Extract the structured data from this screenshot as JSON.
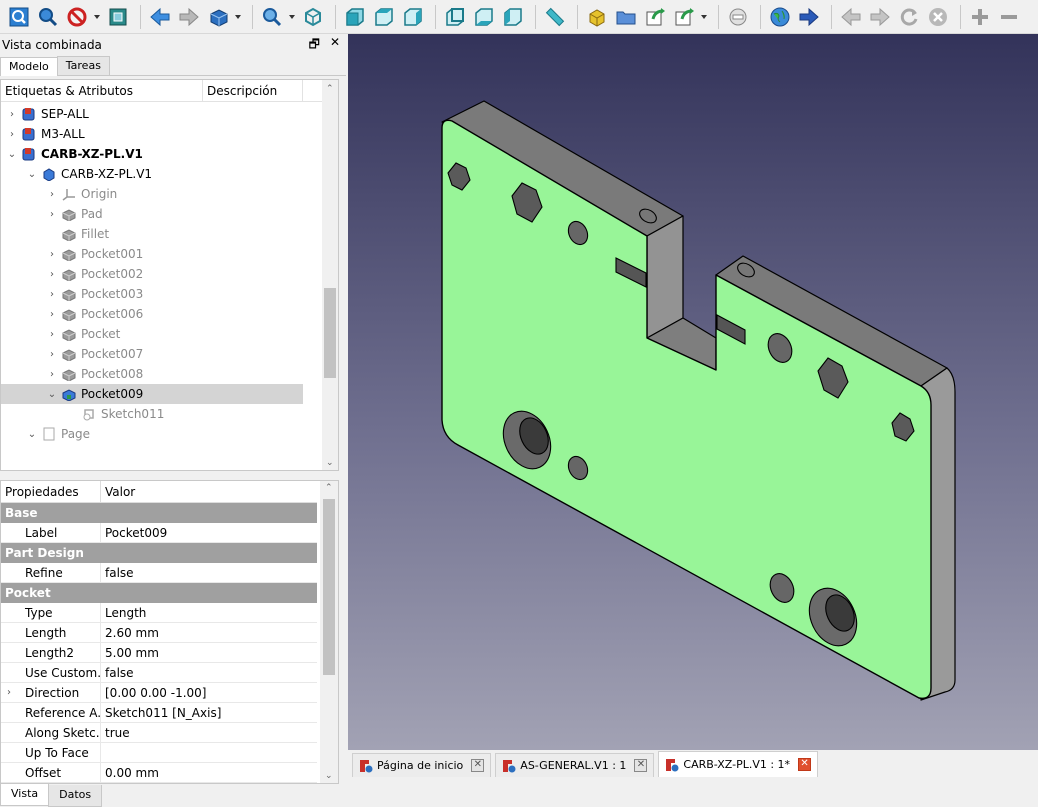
{
  "toolbar": {
    "icons": [
      "fit-all",
      "fit-selection",
      "draw-style",
      "bounding-box",
      "back",
      "forward",
      "navigation-cube",
      "zoom",
      "view-isometric",
      "view-front",
      "view-top",
      "view-right",
      "view-rear",
      "view-bottom",
      "view-left",
      "measure",
      "new-part",
      "new-group",
      "link",
      "link-actions",
      "stop",
      "web-home",
      "web-forward",
      "web-back",
      "web-forward-disabled",
      "refresh",
      "close",
      "zoom-in",
      "zoom-out"
    ]
  },
  "combo": {
    "title": "Vista combinada",
    "float_btn": "🗗",
    "close_btn": "✕",
    "tabs": [
      "Modelo",
      "Tareas"
    ]
  },
  "tree": {
    "col_labels": "Etiquetas & Atributos",
    "col_description": "Descripción",
    "rows": [
      {
        "label": "SEP-ALL",
        "arrow": "›",
        "indent": 0,
        "style": "normal"
      },
      {
        "label": "M3-ALL",
        "arrow": "›",
        "indent": 0,
        "style": "normal"
      },
      {
        "label": "CARB-XZ-PL.V1",
        "arrow": "⌄",
        "indent": 0,
        "style": "bold"
      },
      {
        "label": "CARB-XZ-PL.V1",
        "arrow": "⌄",
        "indent": 1,
        "style": "normal"
      },
      {
        "label": "Origin",
        "arrow": "›",
        "indent": 2,
        "style": "grey"
      },
      {
        "label": "Pad",
        "arrow": "›",
        "indent": 2,
        "style": "grey"
      },
      {
        "label": "Fillet",
        "arrow": "",
        "indent": 2,
        "style": "grey"
      },
      {
        "label": "Pocket001",
        "arrow": "›",
        "indent": 2,
        "style": "grey"
      },
      {
        "label": "Pocket002",
        "arrow": "›",
        "indent": 2,
        "style": "grey"
      },
      {
        "label": "Pocket003",
        "arrow": "›",
        "indent": 2,
        "style": "grey"
      },
      {
        "label": "Pocket006",
        "arrow": "›",
        "indent": 2,
        "style": "grey"
      },
      {
        "label": "Pocket",
        "arrow": "›",
        "indent": 2,
        "style": "grey"
      },
      {
        "label": "Pocket007",
        "arrow": "›",
        "indent": 2,
        "style": "grey"
      },
      {
        "label": "Pocket008",
        "arrow": "›",
        "indent": 2,
        "style": "grey"
      },
      {
        "label": "Pocket009",
        "arrow": "⌄",
        "indent": 2,
        "style": "selected"
      },
      {
        "label": "Sketch011",
        "arrow": "",
        "indent": 3,
        "style": "grey"
      },
      {
        "label": "Page",
        "arrow": "⌄",
        "indent": 1,
        "style": "grey"
      }
    ]
  },
  "props": {
    "col_property": "Propiedades",
    "col_value": "Valor",
    "groups": {
      "base": "Base",
      "part_design": "Part Design",
      "pocket": "Pocket"
    },
    "rows": {
      "label": {
        "k": "Label",
        "v": "Pocket009"
      },
      "refine": {
        "k": "Refine",
        "v": "false"
      },
      "type": {
        "k": "Type",
        "v": "Length"
      },
      "length": {
        "k": "Length",
        "v": "2.60 mm"
      },
      "length2": {
        "k": "Length2",
        "v": "5.00 mm"
      },
      "use_custom": {
        "k": "Use Custom...",
        "v": "false"
      },
      "direction": {
        "k": "Direction",
        "v": "[0.00 0.00 -1.00]"
      },
      "reference": {
        "k": "Reference A...",
        "v": "Sketch011 [N_Axis]"
      },
      "along": {
        "k": "Along Sketc...",
        "v": "true"
      },
      "up_to_face": {
        "k": "Up To Face",
        "v": ""
      },
      "offset": {
        "k": "Offset",
        "v": "0.00 mm"
      }
    },
    "bottom_tabs": [
      "Vista",
      "Datos"
    ]
  },
  "doc_tabs": [
    {
      "label": "Página de inicio",
      "active": false
    },
    {
      "label": "AS-GENERAL.V1 : 1",
      "active": false
    },
    {
      "label": "CARB-XZ-PL.V1 : 1*",
      "active": true
    }
  ],
  "colors": {
    "part_face": "#98f598",
    "part_side": "#8a8a8a",
    "viewport_top": "#33335a",
    "viewport_bottom": "#a2a2b4"
  }
}
